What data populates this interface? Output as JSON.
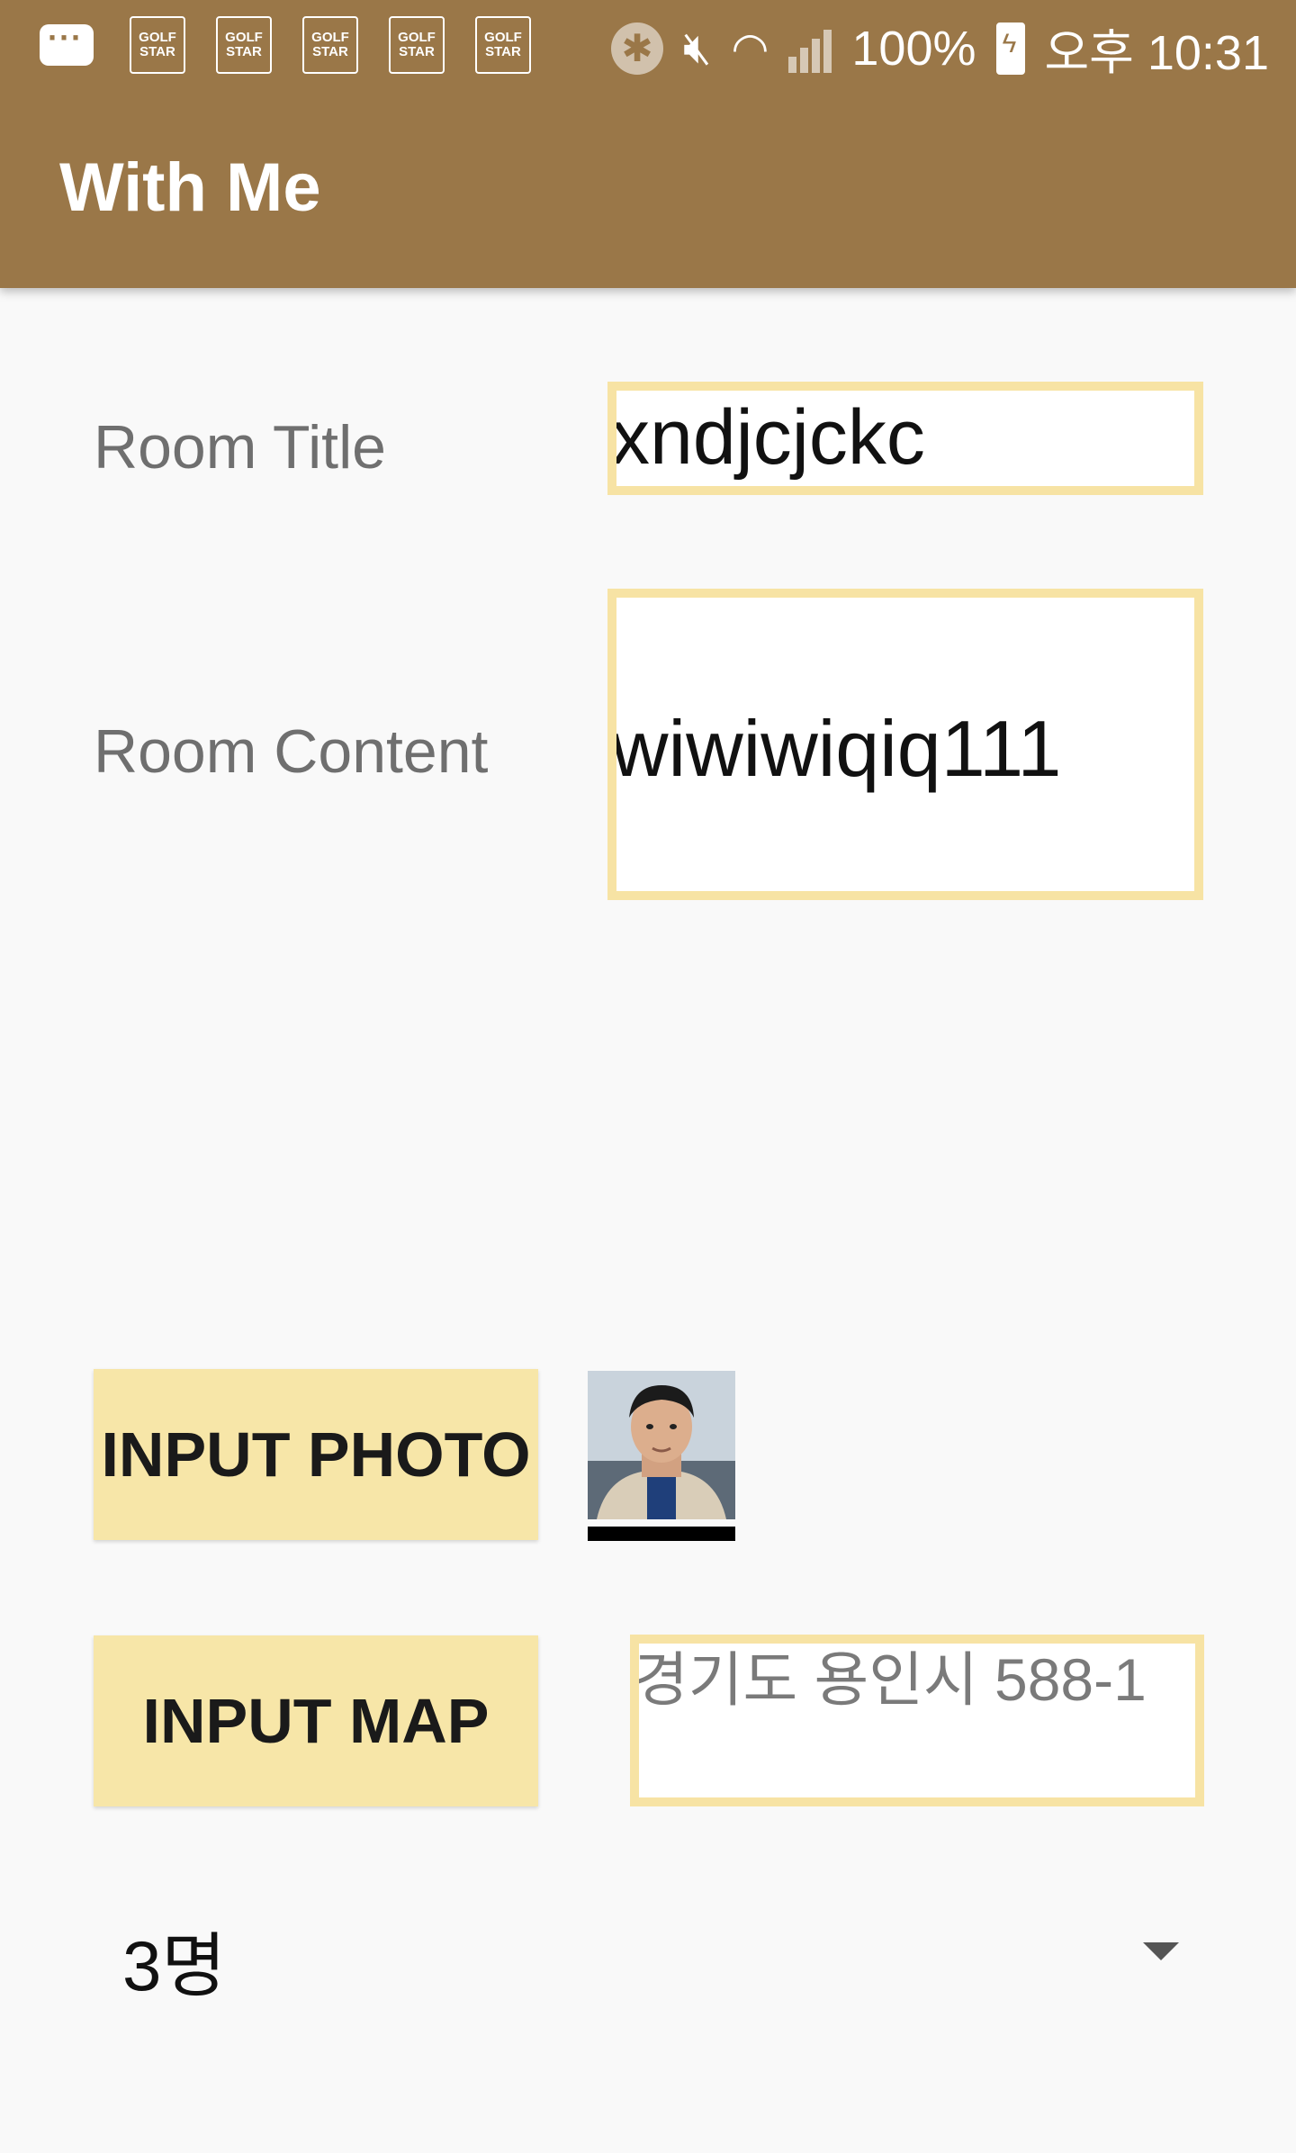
{
  "status_bar": {
    "notification_icons": [
      "chat-icon",
      "golf-star-icon",
      "golf-star-icon",
      "golf-star-icon",
      "golf-star-icon",
      "golf-star-icon"
    ],
    "golf_logo_text": "GOLF STAR",
    "battery": "100%",
    "time": "오후 10:31"
  },
  "app_bar": {
    "title": "With Me",
    "color": "#9a7748"
  },
  "form": {
    "room_title_label": "Room Title",
    "room_title_value": "xndjcjckc",
    "room_content_label": "Room Content",
    "room_content_value": "wiwiwiqiq111",
    "input_photo_label": "INPUT PHOTO",
    "input_map_label": "INPUT MAP",
    "address_value": "경기도 용인시 588-1",
    "people_count_value": "3명"
  }
}
